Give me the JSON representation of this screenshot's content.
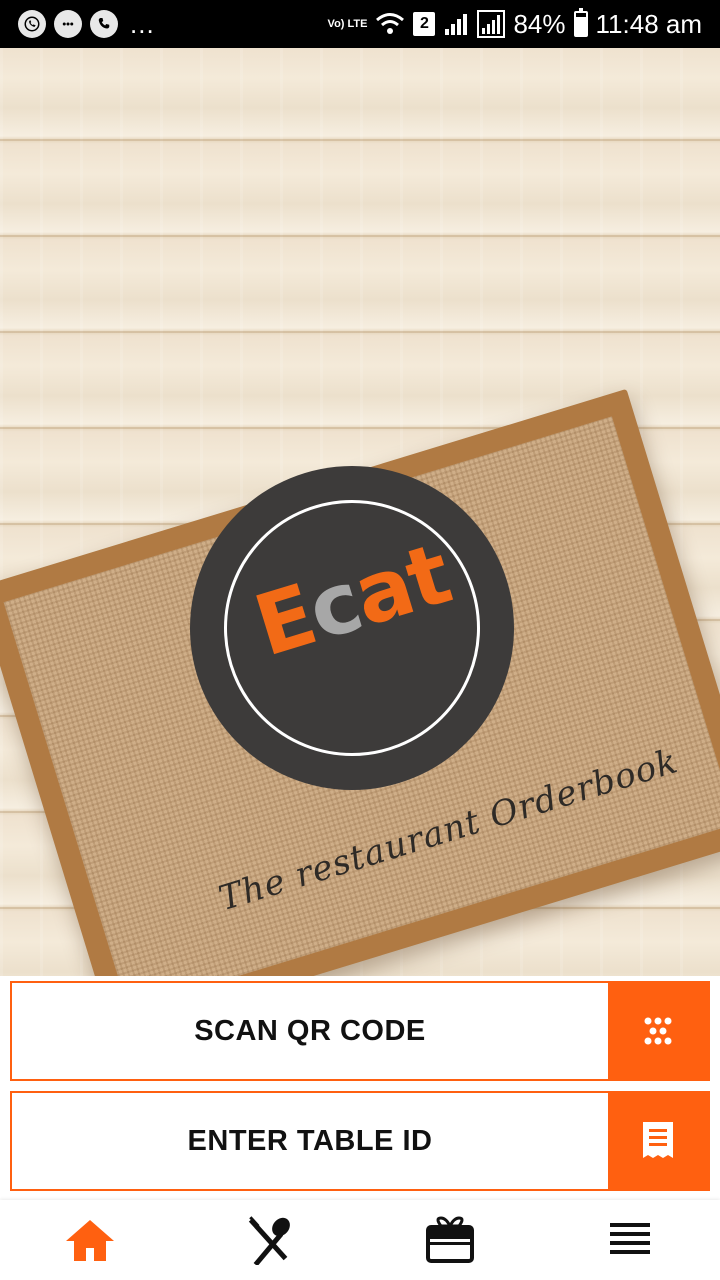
{
  "status_bar": {
    "left_icons": [
      "whatsapp-icon",
      "chat-bubble-icon",
      "phone-icon"
    ],
    "more": "...",
    "volte": "Vo) LTE",
    "sim_badge": "2",
    "battery": "84%",
    "battery_level": 0.84,
    "time": "11:48 am"
  },
  "hero": {
    "logo_letters": {
      "e": "E",
      "c": "c",
      "at": "at"
    },
    "tagline": "The restaurant Orderbook"
  },
  "actions": {
    "scan_label": "SCAN QR CODE",
    "scan_icon": "qr-dots-icon",
    "table_label": "ENTER TABLE ID",
    "table_icon": "receipt-icon"
  },
  "bottom_nav": {
    "items": [
      "home-icon",
      "utensils-icon",
      "gift-box-icon",
      "menu-lines-icon"
    ],
    "active": "home-icon"
  },
  "colors": {
    "accent": "#ff6010",
    "logo_bg": "#3d3b3a",
    "logo_orange": "#f26a16",
    "logo_gray": "#a7a7a7"
  }
}
